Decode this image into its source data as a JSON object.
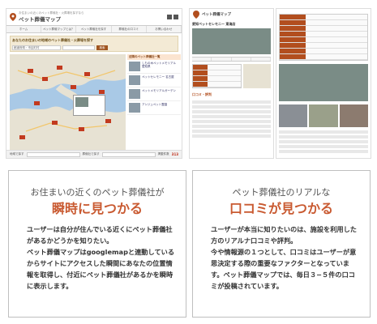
{
  "top_left": {
    "site_name": "ペット葬儀マップ",
    "tagline": "お住まいの近くのペット葬儀社・火葬場を探すなら",
    "nav": [
      "ホーム",
      "ペット葬儀マップとは？",
      "ペット葬儀社を探す",
      "葬儀社の口コミ",
      "お問い合わせ"
    ],
    "search_title": "あなたのお住まいの地域のペット葬儀社・火葬場を探す",
    "search_field": "都道府県・市区町村",
    "search_button": "検索",
    "sidebar_title": "近隣のペット葬儀社一覧",
    "sidebar_items": [
      "しもの木ペットメモリアル 愛知県",
      "ペットセレモニー 名古屋",
      "ペットメモリアルガーデン",
      "アンジュペット霊園"
    ],
    "bottom_label1": "地域で探す",
    "bottom_label2": "葬儀社で探す",
    "bottom_count_label": "掲載件数",
    "bottom_count": "313"
  },
  "top_right": {
    "title": "愛知ペットセレモニー 東海店",
    "review_heading": "口コミ・評判"
  },
  "panel_left": {
    "subtitle": "お住まいの近くのペット葬儀社が",
    "heading": "瞬時に見つかる",
    "paragraphs": [
      "ユーザーは自分が住んでいる近くにペット葬儀社があるかどうかを知りたい。",
      "ペット葬儀マップはgooglemapと連動しているからサイトにアクセスした瞬間にあなたの位置情報を取得し、付近にペット葬儀社があるかを瞬時に表示します。"
    ]
  },
  "panel_right": {
    "subtitle": "ペット葬儀社のリアルな",
    "heading": "口コミが見つかる",
    "paragraphs": [
      "ユーザーが本当に知りたいのは、施設を利用した方のリアルナ口コミや評判。",
      "今や情報源の１つとして、口コミはユーザーが意思決定する際の重要なファクターとなっています。ペット葬儀マップでは、毎日３−５件の口コミが投稿されています。"
    ]
  },
  "colors": {
    "accent": "#c95a31",
    "brand_brown": "#a05520",
    "map_water": "#a9c9e6",
    "map_land": "#e7e2d3"
  }
}
